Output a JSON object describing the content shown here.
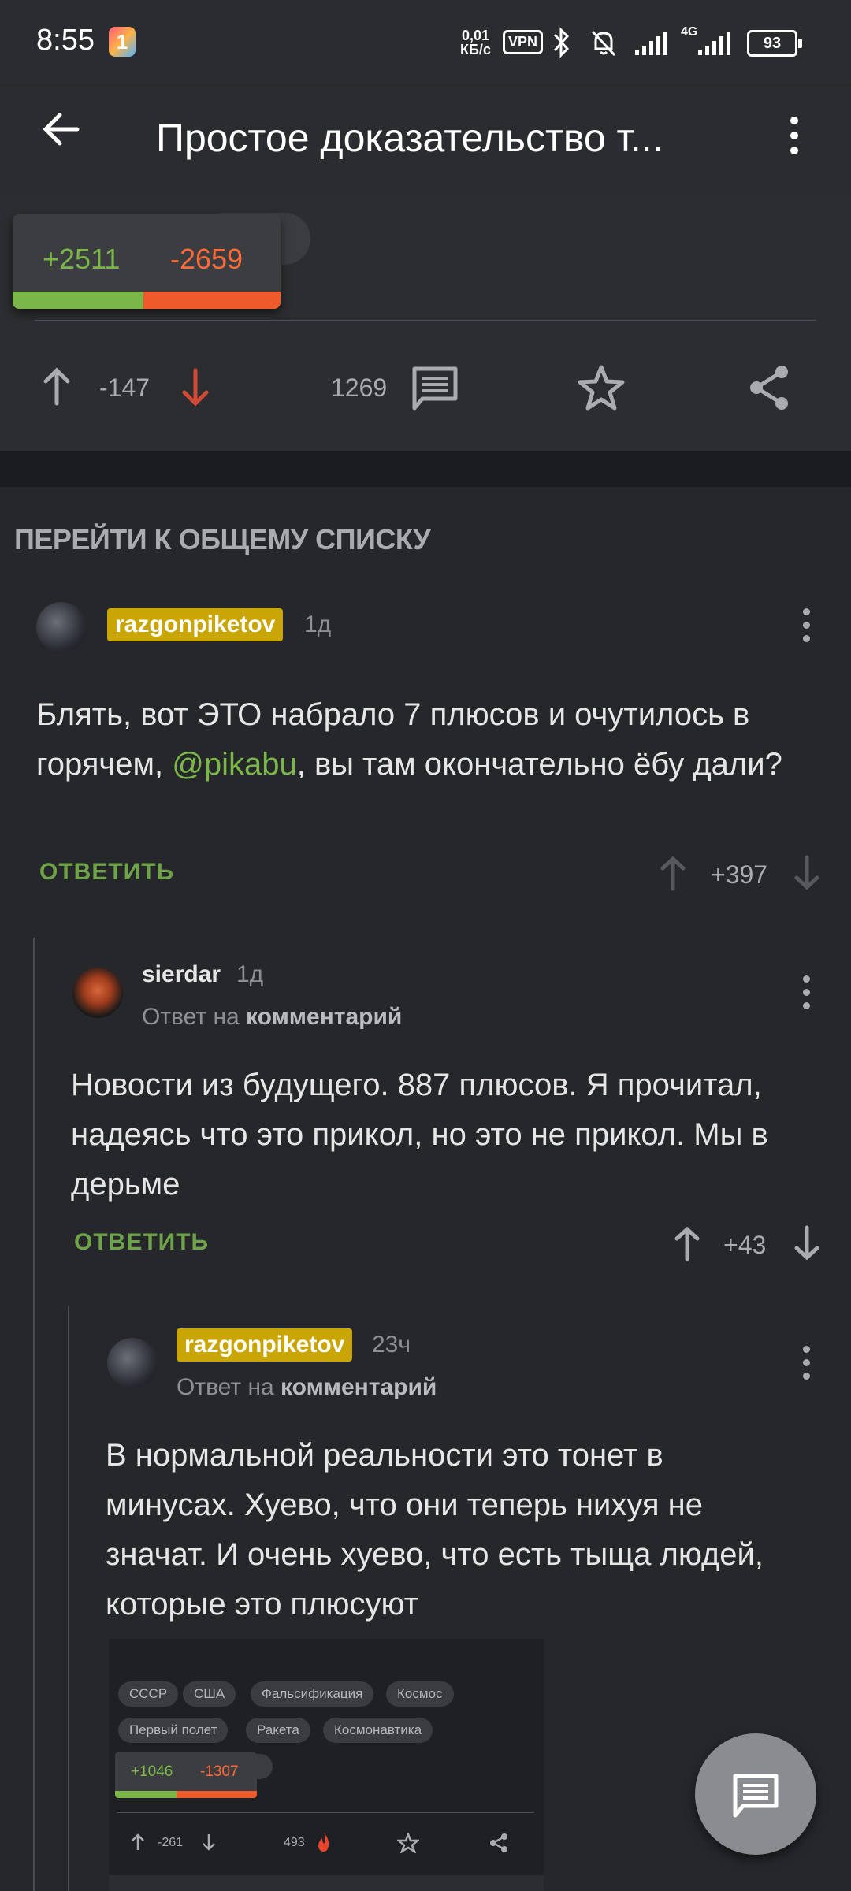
{
  "status_bar": {
    "time": "8:55",
    "net_speed_value": "0,01",
    "net_speed_unit": "КБ/с",
    "vpn": "VPN",
    "network_type": "4G",
    "battery": "93"
  },
  "app_bar": {
    "title": "Простое доказательство т..."
  },
  "post_footer": {
    "rating_plus": "+2511",
    "rating_minus": "-2659",
    "rating_plus_fraction": 0.486,
    "post_score": "-147",
    "comments_count": "1269"
  },
  "goto_list": "ПЕРЕЙТИ К ОБЩЕМУ СПИСКУ",
  "comments": [
    {
      "author": "razgonpiketov",
      "time": "1д",
      "text_before": "Блять, вот ЭТО набрало 7 плюсов и очутилось в горячем, ",
      "mention": "@pikabu",
      "text_after": ", вы там окончательно ёбу дали?",
      "reply_label": "ОТВЕТИТЬ",
      "score": "+397"
    },
    {
      "author": "sierdar",
      "time": "1д",
      "reply_to_prefix": "Ответ на",
      "reply_to_target": "комментарий",
      "text": "Новости из будущего. 887 плюсов. Я прочитал, надеясь что это прикол, но это не прикол. Мы в дерьме",
      "reply_label": "ОТВЕТИТЬ",
      "score": "+43"
    },
    {
      "author": "razgonpiketov",
      "time": "23ч",
      "reply_to_prefix": "Ответ на",
      "reply_to_target": "комментарий",
      "text": "В нормальной реальности это тонет в минусах. Хуево, что они теперь нихуя не значат. И очень хуево, что есть тыща людей, которые это плюсуют"
    }
  ],
  "embedded_image": {
    "tags": [
      "СССР",
      "США",
      "Фальсификация",
      "Космос",
      "Первый полет",
      "Ракета",
      "Космонавтика"
    ],
    "rating_plus": "+1046",
    "rating_minus": "-1307",
    "score": "-261",
    "comments": "493"
  },
  "colors": {
    "background": "#25272b",
    "plus": "#7ab648",
    "minus": "#ee5a2a",
    "author_badge": "#c9a606",
    "upvote_icon": "#a9abaf",
    "downvote_icon": "#d24a35"
  }
}
